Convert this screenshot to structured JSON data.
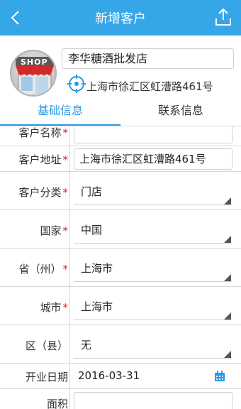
{
  "header": {
    "title": "新增客户",
    "back_icon": "chevron-left-icon",
    "share_icon": "share-upload-icon"
  },
  "profile": {
    "avatar_icon": "shop-storefront-icon",
    "avatar_sign": "SHOP",
    "name": "李华糖酒批发店",
    "location_icon": "locate-target-icon",
    "address": "上海市徐汇区虹漕路461号"
  },
  "tabs": [
    {
      "label": "基础信息",
      "active": true
    },
    {
      "label": "联系信息",
      "active": false
    }
  ],
  "form": {
    "customer_name": {
      "label": "客户名称",
      "required": "*",
      "value": ""
    },
    "customer_address": {
      "label": "客户地址",
      "required": "*",
      "value": "上海市徐汇区虹漕路461号"
    },
    "customer_category": {
      "label": "客户分类",
      "required": "*",
      "value": "门店"
    },
    "country": {
      "label": "国家",
      "required": "*",
      "value": "中国"
    },
    "province": {
      "label": "省（州）",
      "required": "*",
      "value": "上海市"
    },
    "city": {
      "label": "城市",
      "required": "*",
      "value": "上海市"
    },
    "district": {
      "label": "区（县）",
      "value": "无"
    },
    "open_date": {
      "label": "开业日期",
      "value": "2016-03-31",
      "icon": "calendar-icon"
    },
    "area": {
      "label": "面积",
      "value": ""
    }
  },
  "colors": {
    "header_bg": "#35a7e8",
    "accent": "#2a9be0",
    "required": "#e02020"
  }
}
